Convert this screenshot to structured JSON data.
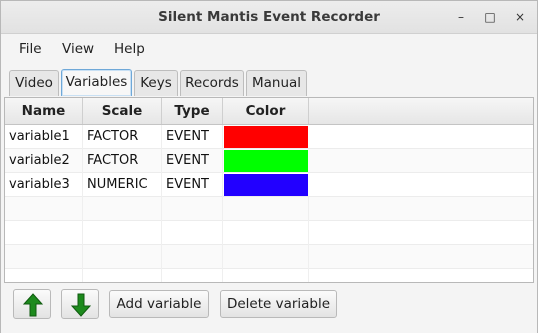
{
  "window": {
    "title": "Silent Mantis Event Recorder",
    "controls": {
      "minimize": "–",
      "maximize": "□",
      "close": "×"
    }
  },
  "menubar": {
    "items": [
      "File",
      "View",
      "Help"
    ]
  },
  "tabs": {
    "items": [
      "Video",
      "Variables",
      "Keys",
      "Records",
      "Manual"
    ],
    "active": "Variables"
  },
  "table": {
    "columns": [
      "Name",
      "Scale",
      "Type",
      "Color"
    ],
    "rows": [
      {
        "name": "variable1",
        "scale": "FACTOR",
        "type": "EVENT",
        "color": "#ff0000"
      },
      {
        "name": "variable2",
        "scale": "FACTOR",
        "type": "EVENT",
        "color": "#00ff00"
      },
      {
        "name": "variable3",
        "scale": "NUMERIC",
        "type": "EVENT",
        "color": "#2200ff"
      }
    ]
  },
  "buttons": {
    "move_up_icon": "up-arrow-icon",
    "move_down_icon": "down-arrow-icon",
    "add_variable": "Add variable",
    "delete_variable": "Delete variable"
  },
  "colors": {
    "arrow": "#1d8a1d",
    "active_tab_border": "#6fa8d8"
  }
}
